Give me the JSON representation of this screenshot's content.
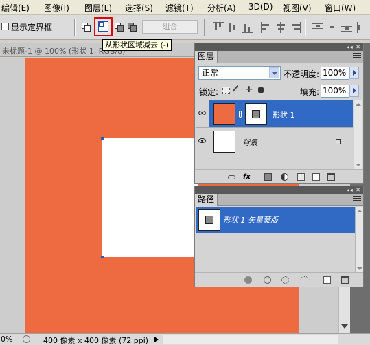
{
  "menu": {
    "items": [
      "编辑(E)",
      "图像(I)",
      "图层(L)",
      "选择(S)",
      "滤镜(T)",
      "分析(A)",
      "3D(D)",
      "视图(V)",
      "窗口(W)"
    ]
  },
  "options_bar": {
    "show_bounding_box_label": "显示定界框",
    "combine_label": "组合"
  },
  "tooltip": "从形状区域减去 (-)",
  "document": {
    "title": "未标题-1 @ 100% (形状 1, RGB/8)",
    "canvas_color": "#ee6a40",
    "shape_color": "#ffffff"
  },
  "status_bar": {
    "zoom": "0%",
    "doc_info": "400 像素 x 400 像素 (72 ppi)"
  },
  "layers_panel": {
    "tab_label": "图层",
    "blend_mode": "正常",
    "opacity_label": "不透明度:",
    "opacity_value": "100%",
    "lock_label": "锁定:",
    "fill_label": "填充:",
    "fill_value": "100%",
    "layers": [
      {
        "name": "形状 1",
        "selected": true,
        "thumb_color": "#ee6a40"
      },
      {
        "name": "背景",
        "selected": false,
        "thumb_color": "#ffffff"
      }
    ]
  },
  "paths_panel": {
    "tab_label": "路径",
    "paths": [
      {
        "name": "形状 1 矢量蒙版",
        "selected": true
      }
    ]
  },
  "colors": {
    "selection_blue": "#316ac5",
    "red_highlight": "#e00000"
  }
}
